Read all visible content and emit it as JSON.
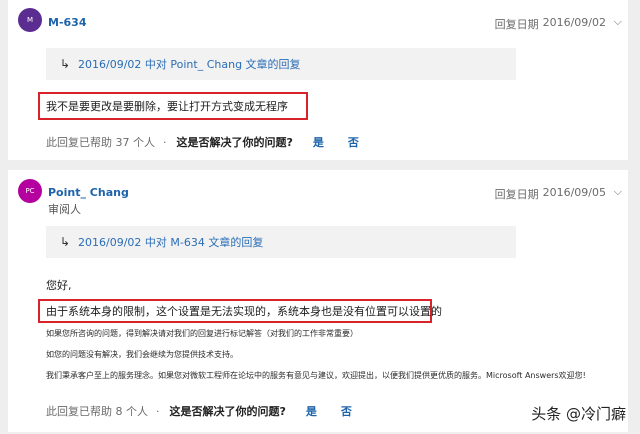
{
  "reply1": {
    "avatar_initials": "M",
    "author": "M-634",
    "date_label": "回复日期",
    "date": "2016/09/02",
    "quote_link": "2016/09/02 中对 Point_ Chang 文章的回复",
    "message": "我不是要更改是要删除，要让打开方式变成无程序",
    "helpful_text": "此回复已帮助 37 个人",
    "question": "这是否解决了你的问题?",
    "yes_label": "是",
    "no_label": "否"
  },
  "reply2": {
    "avatar_initials": "PC",
    "author": "Point_ Chang",
    "role": "审阅人",
    "date_label": "回复日期",
    "date": "2016/09/05",
    "quote_link": "2016/09/02 中对 M-634 文章的回复",
    "greeting": "您好,",
    "message": "由于系统本身的限制，这个设置是无法实现的，系统本身也是没有位置可以设置的",
    "note1": "如果您所咨询的问题，得到解决请对我们的回复进行标记解答（对我们的工作非常重要）",
    "note2": "如您的问题没有解决，我们会继续为您提供技术支持。",
    "note3": "我们秉承客户至上的服务理念。如果您对微软工程师在论坛中的服务有意见与建议，欢迎提出，以便我们提供更优质的服务。Microsoft Answers欢迎您!",
    "helpful_text": "此回复已帮助 8 个人",
    "question": "这是否解决了你的问题?",
    "yes_label": "是",
    "no_label": "否"
  },
  "watermark": "头条 @冷门癖",
  "icons": {
    "chevron": "chevron-down-icon",
    "reply_arrow": "reply-arrow-icon"
  }
}
